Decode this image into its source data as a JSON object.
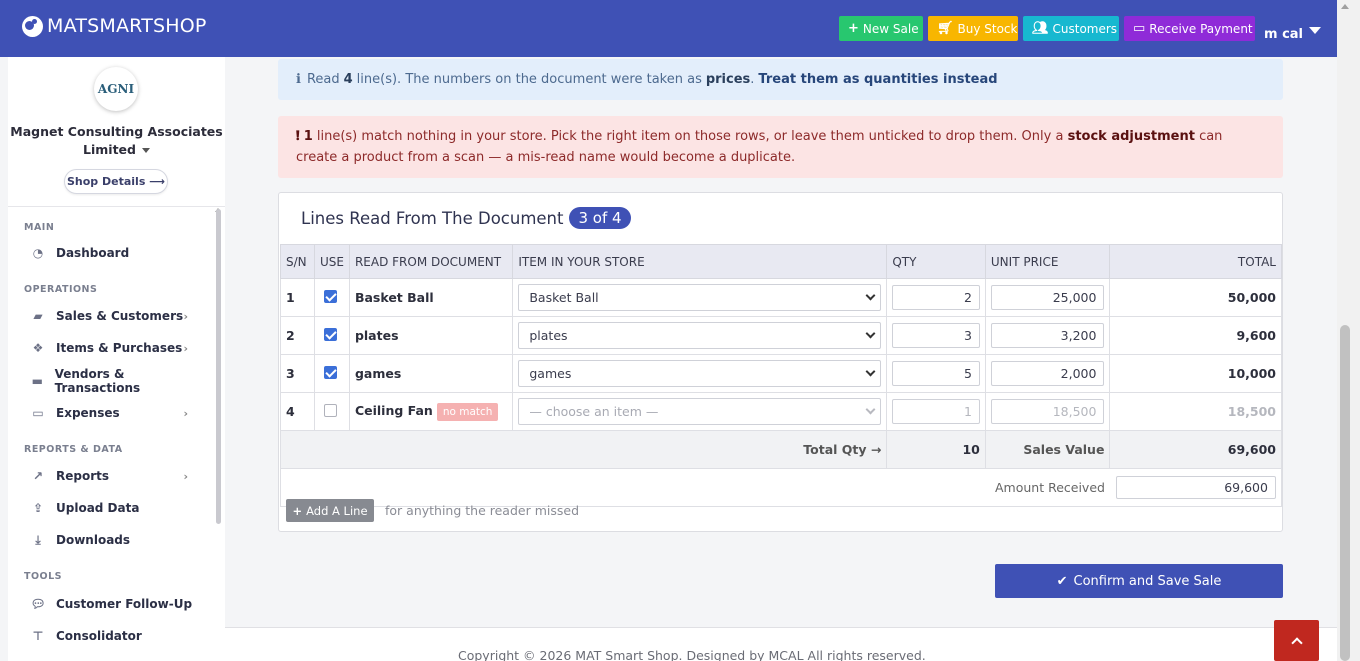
{
  "app": {
    "brand": "MATSMARTSHOP"
  },
  "topbar": {
    "new_sale": "New Sale",
    "buy_stock": "Buy Stock",
    "customers": "Customers",
    "receive_payment": "Receive Payment",
    "user": "m cal"
  },
  "sidebar": {
    "logo_text": "AGNI",
    "shop_name": "Magnet Consulting Associates Limited",
    "shop_details": "Shop Details",
    "sections": {
      "main": "MAIN",
      "operations": "OPERATIONS",
      "reports": "REPORTS & DATA",
      "tools": "TOOLS"
    },
    "items": {
      "dashboard": "Dashboard",
      "sales": "Sales & Customers",
      "items": "Items & Purchases",
      "vendors": "Vendors & Transactions",
      "expenses": "Expenses",
      "reports": "Reports",
      "upload": "Upload Data",
      "downloads": "Downloads",
      "followup": "Customer Follow-Up",
      "consolidator": "Consolidator"
    }
  },
  "info_alert": {
    "prefix": "Read",
    "count": "4",
    "middle": "line(s). The numbers on the document were taken as",
    "emph": "prices",
    "link": "Treat them as quantities instead"
  },
  "danger_alert": {
    "count": "1",
    "text1": "line(s) match nothing in your store. Pick the right item on those rows, or leave them unticked to drop them. Only a",
    "emph": "stock adjustment",
    "text2": "can create a product from a scan — a mis-read name would become a duplicate."
  },
  "card": {
    "title": "Lines Read From The Document",
    "badge": "3 of 4"
  },
  "table": {
    "headers": {
      "sn": "S/N",
      "use": "USE",
      "read": "READ FROM DOCUMENT",
      "item": "ITEM IN YOUR STORE",
      "qty": "QTY",
      "price": "UNIT PRICE",
      "total": "TOTAL"
    },
    "rows": [
      {
        "sn": "1",
        "read": "Basket Ball",
        "item": "Basket Ball",
        "qty": "2",
        "price": "25,000",
        "total": "50,000"
      },
      {
        "sn": "2",
        "read": "plates",
        "item": "plates",
        "qty": "3",
        "price": "3,200",
        "total": "9,600"
      },
      {
        "sn": "3",
        "read": "games",
        "item": "games",
        "qty": "5",
        "price": "2,000",
        "total": "10,000"
      },
      {
        "sn": "4",
        "read": "Ceiling Fan",
        "badge": "no match",
        "item": "— choose an item —",
        "qty": "1",
        "price": "18,500",
        "total": "18,500"
      }
    ],
    "total_qty_label": "Total Qty →",
    "total_qty": "10",
    "sales_value_label": "Sales Value",
    "sales_value": "69,600",
    "amount_received_label": "Amount Received",
    "amount_received": "69,600"
  },
  "add_line": {
    "label": "Add A Line",
    "hint": "for anything the reader missed"
  },
  "confirm": {
    "label": "Confirm and Save Sale"
  },
  "footer": {
    "text": "Copyright © 2026 MAT Smart Shop. Designed by MCAL All rights reserved."
  },
  "colors": {
    "primary": "#3f51b5",
    "success": "#28c76f",
    "warning": "#f8b600",
    "info": "#17b8d0",
    "purple": "#8f2bd8",
    "danger": "#c0281f"
  }
}
